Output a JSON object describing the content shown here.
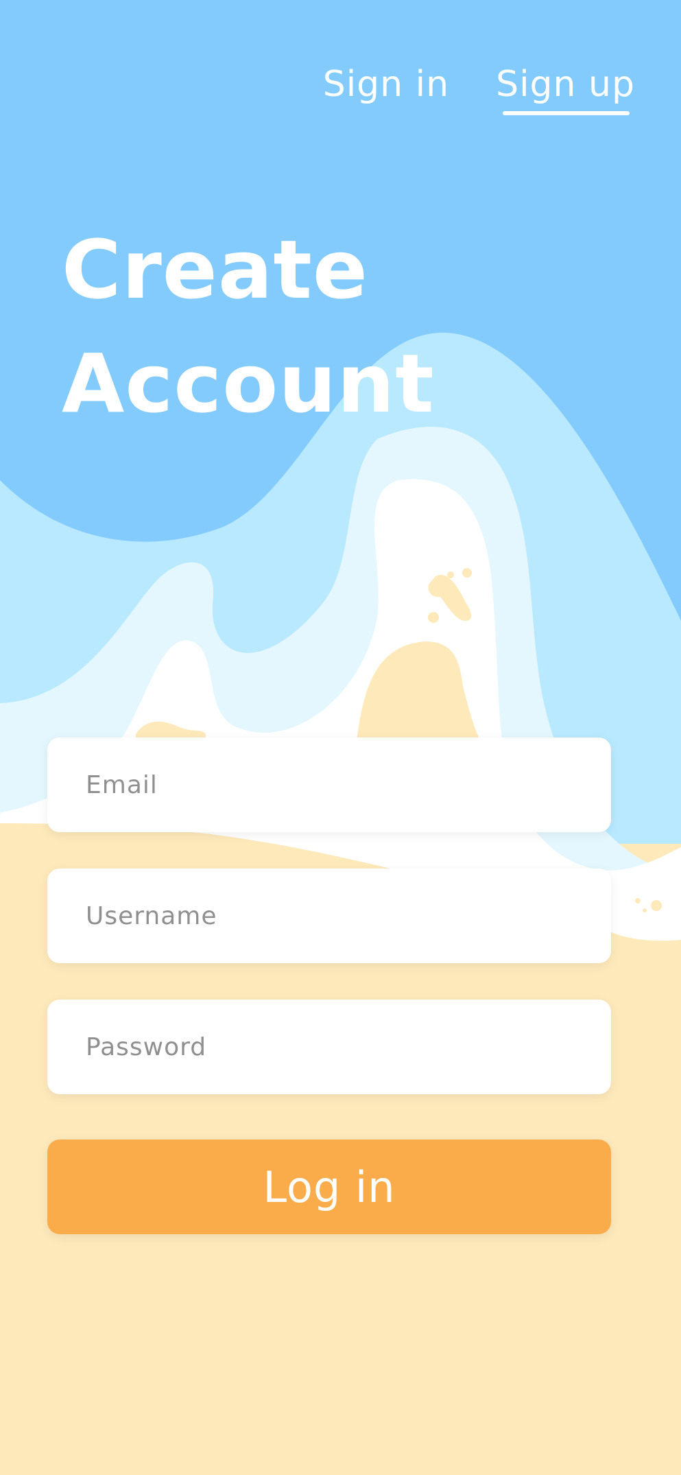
{
  "nav": {
    "sign_in_label": "Sign in",
    "sign_up_label": "Sign up",
    "active_tab": "sign_up"
  },
  "header": {
    "title_line_1": "Create",
    "title_line_2": "Account"
  },
  "form": {
    "email_placeholder": "Email",
    "email_value": "",
    "username_placeholder": "Username",
    "username_value": "",
    "password_placeholder": "Password",
    "password_value": "",
    "submit_label": "Log in"
  },
  "colors": {
    "sky": "#84CBFD",
    "wave_light": "#B8E9FF",
    "wave_lighter": "#E4F7FF",
    "foam": "#FFFFFF",
    "sand": "#FEE9BB",
    "accent": "#FAAC4A",
    "placeholder_text": "#8F8F8F"
  }
}
